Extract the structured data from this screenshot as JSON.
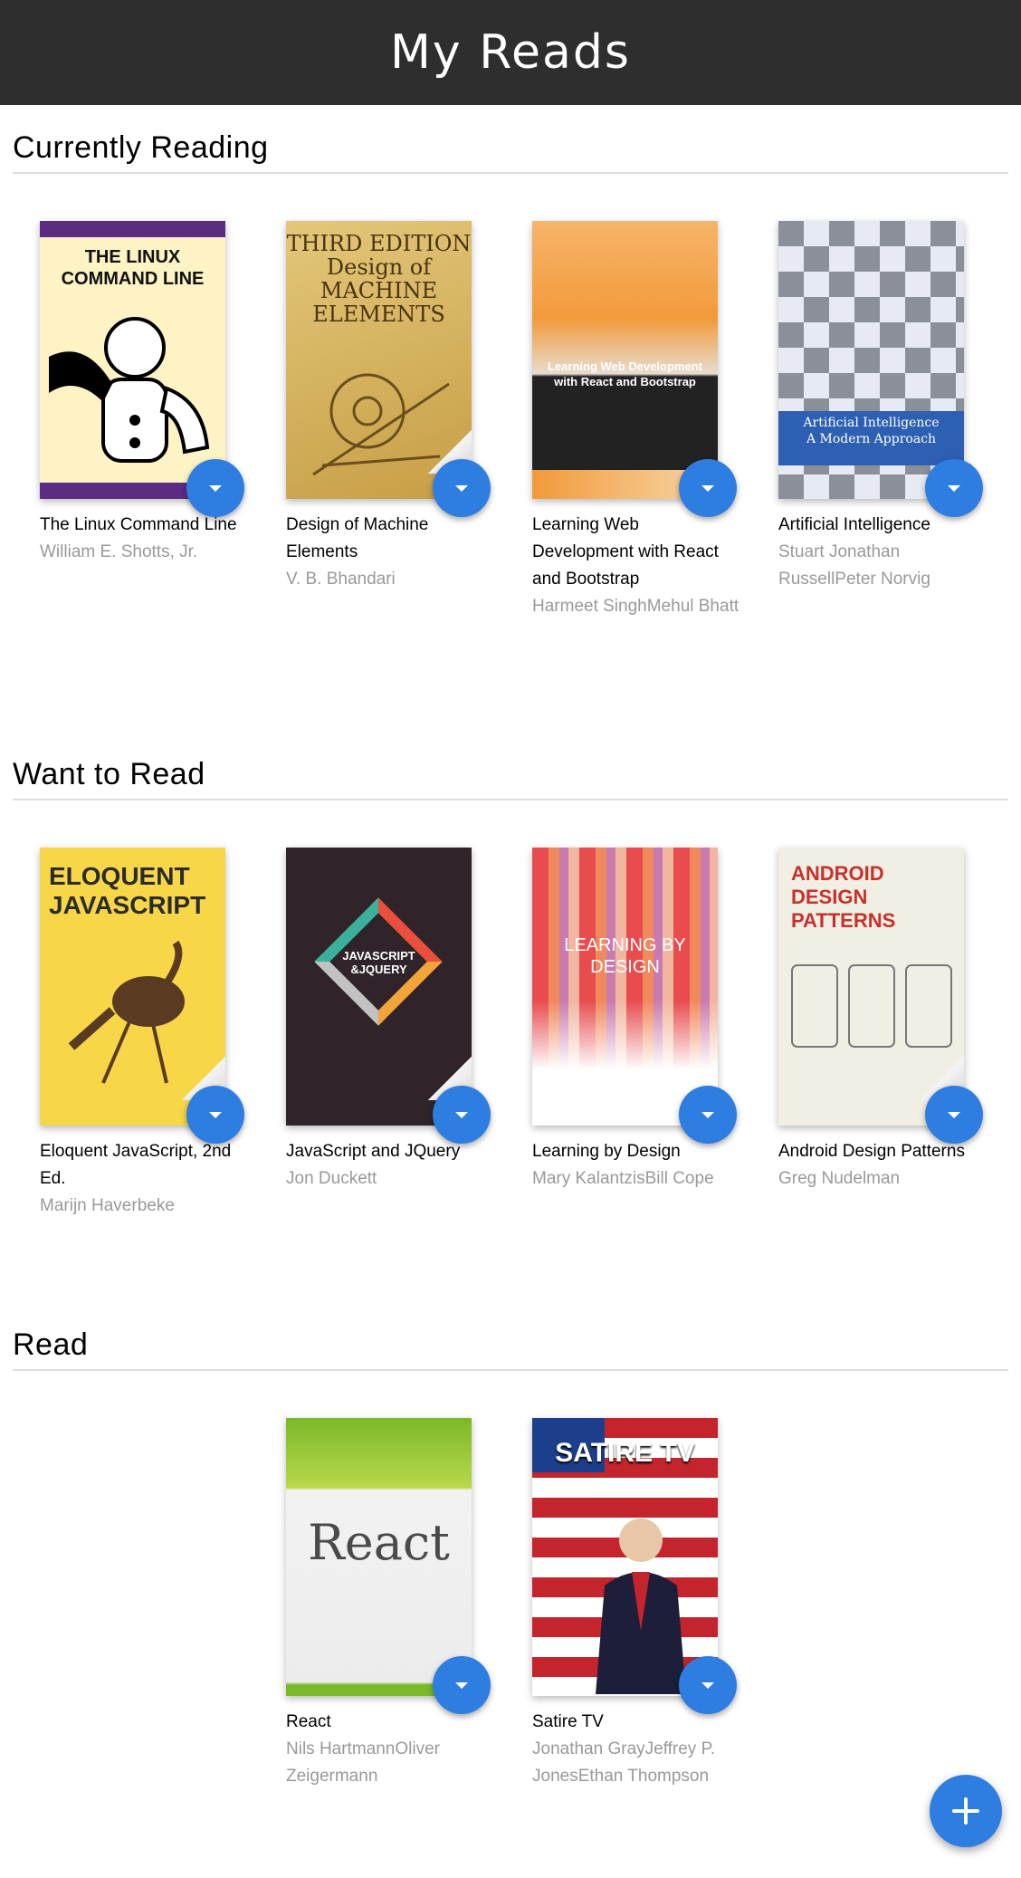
{
  "header": {
    "title": "My Reads"
  },
  "colors": {
    "accent": "#2e7de1",
    "header_bg": "#2e2e2e",
    "author_text": "#999999"
  },
  "shelves": [
    {
      "title": "Currently Reading",
      "books": [
        {
          "title": "The Linux Command Line",
          "authors": "William E. Shotts, Jr.",
          "cover_text": "THE LINUX\nCOMMAND LINE"
        },
        {
          "title": "Design of Machine Elements",
          "authors": "V. B. Bhandari",
          "cover_text": "THIRD EDITION\nDesign of\nMACHINE\nELEMENTS"
        },
        {
          "title": "Learning Web Development with React and Bootstrap",
          "authors": "Harmeet SinghMehul Bhatt",
          "cover_text": "Learning Web Development\nwith React and Bootstrap"
        },
        {
          "title": "Artificial Intelligence",
          "authors": "Stuart Jonathan RussellPeter Norvig",
          "cover_text": "Artificial Intelligence\nA Modern Approach"
        }
      ]
    },
    {
      "title": "Want to Read",
      "books": [
        {
          "title": "Eloquent JavaScript, 2nd Ed.",
          "authors": "Marijn Haverbeke",
          "cover_text": "ELOQUENT\nJAVASCRIPT"
        },
        {
          "title": "JavaScript and JQuery",
          "authors": "Jon Duckett",
          "cover_text": "JAVASCRIPT\n&JQUERY"
        },
        {
          "title": "Learning by Design",
          "authors": "Mary KalantzisBill Cope",
          "cover_text": "LEARNING BY DESIGN"
        },
        {
          "title": "Android Design Patterns",
          "authors": "Greg Nudelman",
          "cover_text": "ANDROID\nDESIGN\nPATTERNS"
        }
      ]
    },
    {
      "title": "Read",
      "books": [
        {
          "title": "React",
          "authors": "Nils HartmannOliver Zeigermann",
          "cover_text": "React"
        },
        {
          "title": "Satire TV",
          "authors": "Jonathan GrayJeffrey P. JonesEthan Thompson",
          "cover_text": "SATIRE TV"
        }
      ]
    }
  ],
  "add_button": {
    "icon": "plus-icon"
  },
  "shelf_changer": {
    "icon": "arrow-down-icon"
  }
}
